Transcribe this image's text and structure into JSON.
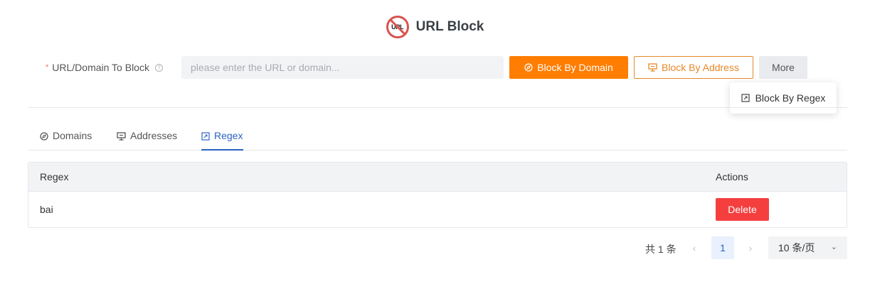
{
  "header": {
    "logo_text": "URL",
    "title": "URL Block"
  },
  "form": {
    "label": "URL/Domain To Block",
    "required_mark": "*",
    "help_glyph": "?",
    "input_value": "",
    "input_placeholder": "please enter the URL or domain...",
    "btn_domain": "Block By Domain",
    "btn_address": "Block By Address",
    "btn_more": "More"
  },
  "dropdown": {
    "item": "Block By Regex"
  },
  "tabs": [
    {
      "label": "Domains",
      "icon": "compass-icon"
    },
    {
      "label": "Addresses",
      "icon": "monitor-icon"
    },
    {
      "label": "Regex",
      "icon": "regex-icon",
      "active": true
    }
  ],
  "table": {
    "columns": [
      "Regex",
      "Actions"
    ],
    "rows": [
      {
        "regex": "bai",
        "action": "Delete"
      }
    ]
  },
  "pagination": {
    "total": "共 1 条",
    "prev": "‹",
    "next": "›",
    "current_page": "1",
    "page_size": "10 条/页",
    "page_size_chevron": "⌄"
  },
  "colors": {
    "primary_orange": "#ff7d00",
    "outline_orange": "#e6892a",
    "active_blue": "#2a63c2",
    "delete_red": "#f53f3f",
    "logo_red": "#d9534f"
  }
}
